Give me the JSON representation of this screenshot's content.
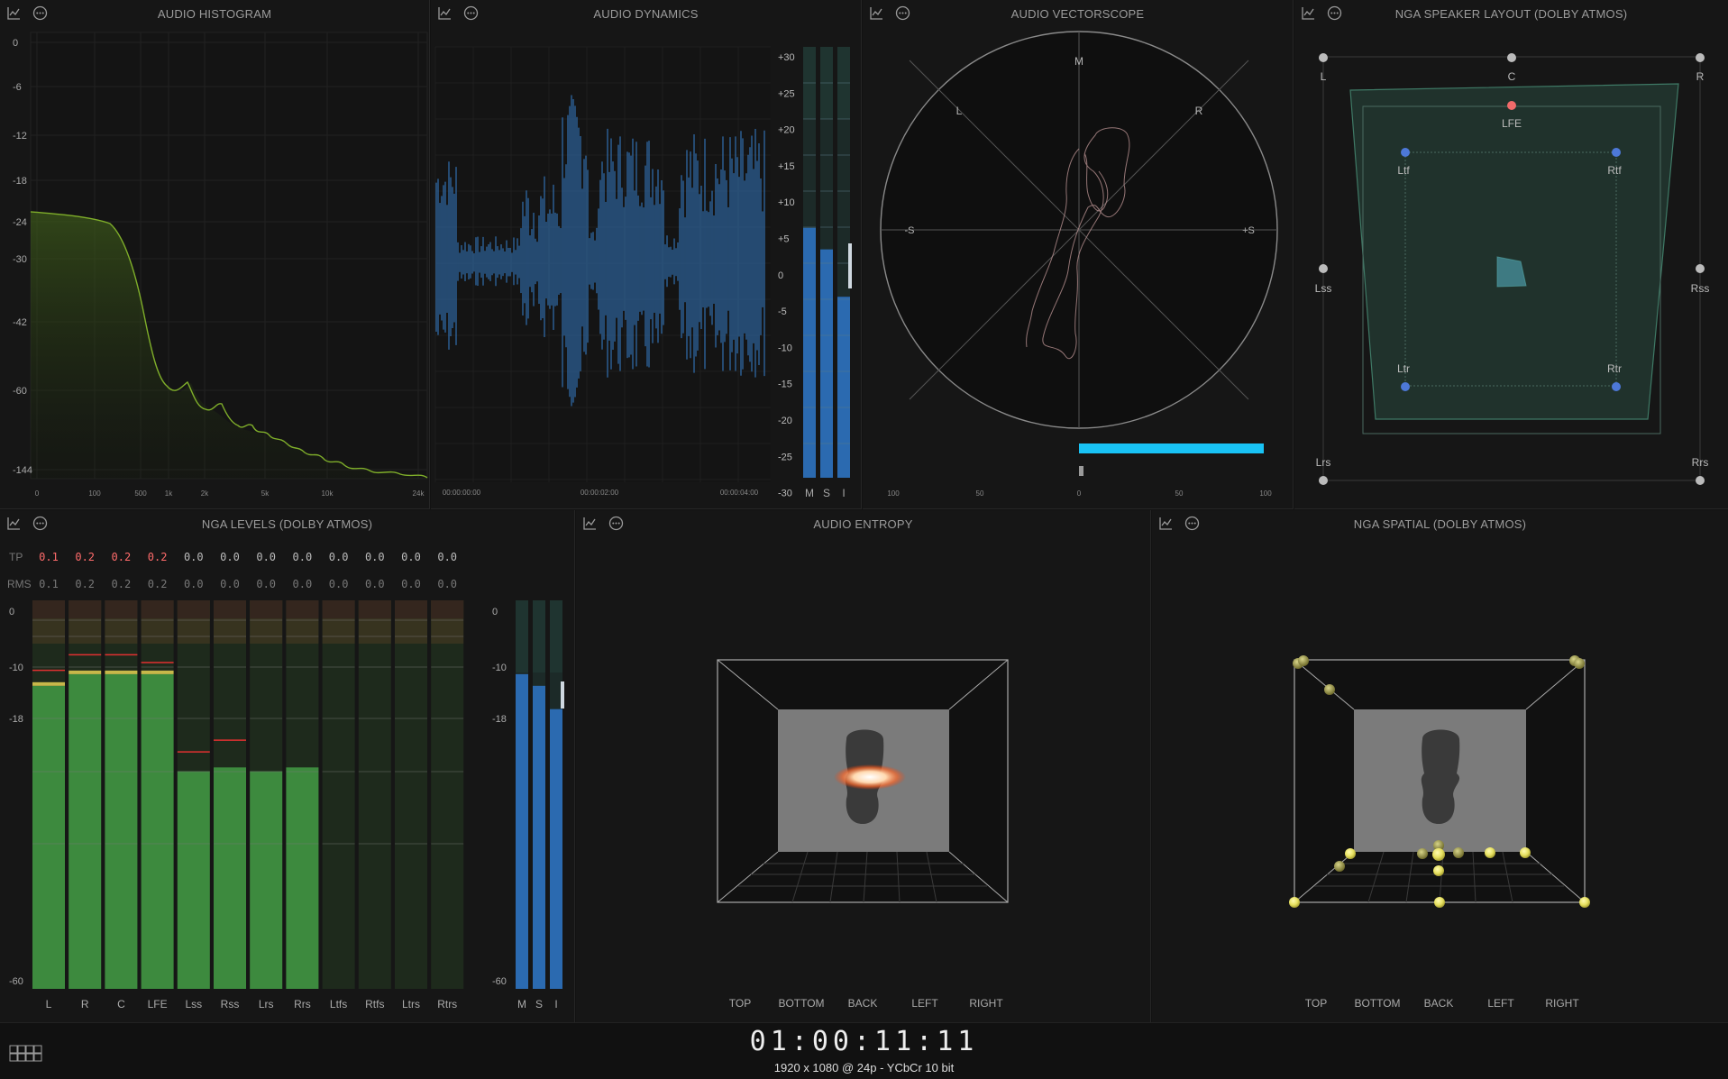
{
  "panels": {
    "histogram": {
      "title": "AUDIO HISTOGRAM",
      "y_ticks": [
        "0",
        "-6",
        "-12",
        "-18",
        "-24",
        "-30",
        "-42",
        "-60",
        "-144"
      ],
      "x_ticks": [
        "0",
        "100",
        "500",
        "1k",
        "2k",
        "5k",
        "10k",
        "24k"
      ]
    },
    "dynamics": {
      "title": "AUDIO DYNAMICS",
      "time_ticks": [
        "00:00:00:00",
        "00:00:02:00",
        "00:00:04:00"
      ],
      "scale": [
        "+30",
        "+25",
        "+20",
        "+15",
        "+10",
        "+5",
        "0",
        "-5",
        "-10",
        "-15",
        "-20",
        "-25",
        "-30"
      ],
      "meter_labels": [
        "M",
        "S",
        "I"
      ],
      "meter_levels": [
        0.58,
        0.53,
        0.42
      ]
    },
    "vectorscope": {
      "title": "AUDIO VECTORSCOPE",
      "labels": {
        "m": "M",
        "l": "L",
        "r": "R",
        "neg_s": "-S",
        "pos_s": "+S"
      },
      "x_ticks": [
        "100",
        "50",
        "0",
        "50",
        "100"
      ],
      "correlation": 0.8
    },
    "speaker_layout": {
      "title": "NGA SPEAKER LAYOUT (DOLBY ATMOS)",
      "speakers": [
        "L",
        "C",
        "R",
        "LFE",
        "Ltf",
        "Rtf",
        "Lss",
        "Rss",
        "Ltr",
        "Rtr",
        "Lrs",
        "Rrs"
      ]
    },
    "levels": {
      "title": "NGA LEVELS (DOLBY ATMOS)",
      "tp_label": "TP",
      "rms_label": "RMS",
      "channels": [
        {
          "name": "L",
          "tp": "0.1",
          "rms": "0.1",
          "level": 0.78,
          "peak": 0.82
        },
        {
          "name": "R",
          "tp": "0.2",
          "rms": "0.2",
          "level": 0.81,
          "peak": 0.86
        },
        {
          "name": "C",
          "tp": "0.2",
          "rms": "0.2",
          "level": 0.81,
          "peak": 0.86
        },
        {
          "name": "LFE",
          "tp": "0.2",
          "rms": "0.2",
          "level": 0.81,
          "peak": 0.84
        },
        {
          "name": "Lss",
          "tp": "0.0",
          "rms": "0.0",
          "level": 0.56,
          "peak": 0.61
        },
        {
          "name": "Rss",
          "tp": "0.0",
          "rms": "0.0",
          "level": 0.57,
          "peak": 0.64
        },
        {
          "name": "Lrs",
          "tp": "0.0",
          "rms": "0.0",
          "level": 0.56,
          "peak": null
        },
        {
          "name": "Rrs",
          "tp": "0.0",
          "rms": "0.0",
          "level": 0.57,
          "peak": null
        },
        {
          "name": "Ltfs",
          "tp": "0.0",
          "rms": "0.0",
          "level": 0,
          "peak": null
        },
        {
          "name": "Rtfs",
          "tp": "0.0",
          "rms": "0.0",
          "level": 0,
          "peak": null
        },
        {
          "name": "Ltrs",
          "tp": "0.0",
          "rms": "0.0",
          "level": 0,
          "peak": null
        },
        {
          "name": "Rtrs",
          "tp": "0.0",
          "rms": "0.0",
          "level": 0,
          "peak": null
        }
      ],
      "scale": [
        "0",
        "-10",
        "-18",
        "-60"
      ],
      "loudness_scale": [
        "0",
        "-10",
        "-18",
        "-60"
      ],
      "loudness_labels": [
        "M",
        "S",
        "I"
      ],
      "loudness_levels": [
        0.81,
        0.78,
        0.72
      ]
    },
    "entropy": {
      "title": "AUDIO ENTROPY",
      "views": [
        "TOP",
        "BOTTOM",
        "BACK",
        "LEFT",
        "RIGHT"
      ]
    },
    "spatial": {
      "title": "NGA SPATIAL (DOLBY ATMOS)",
      "views": [
        "TOP",
        "BOTTOM",
        "BACK",
        "LEFT",
        "RIGHT"
      ]
    }
  },
  "footer": {
    "timecode": "01:00:11:11",
    "format": "1920 x 1080 @ 24p - YCbCr 10 bit"
  },
  "colors": {
    "waveform": "#2f6aa6",
    "spectrum": "#7fae2a",
    "meter_green": "#3d8a3e",
    "loudness_blue": "#2b6ab0",
    "correlation": "#19c3f5",
    "speaker_tp": "#ff6b6b"
  }
}
